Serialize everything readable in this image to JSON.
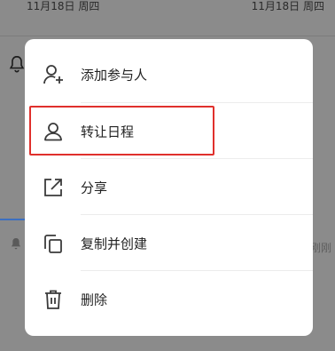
{
  "background": {
    "date_left": "11月18日 周四",
    "date_right": "11月18日 周四",
    "right_text": "刚刚"
  },
  "menu": {
    "items": [
      {
        "label": "添加参与人",
        "icon": "add-person-icon"
      },
      {
        "label": "转让日程",
        "icon": "person-transfer-icon"
      },
      {
        "label": "分享",
        "icon": "share-icon"
      },
      {
        "label": "复制并创建",
        "icon": "copy-icon"
      },
      {
        "label": "删除",
        "icon": "trash-icon"
      }
    ]
  },
  "colors": {
    "highlight": "#e0302c",
    "overlay": "#8b8b8b"
  }
}
